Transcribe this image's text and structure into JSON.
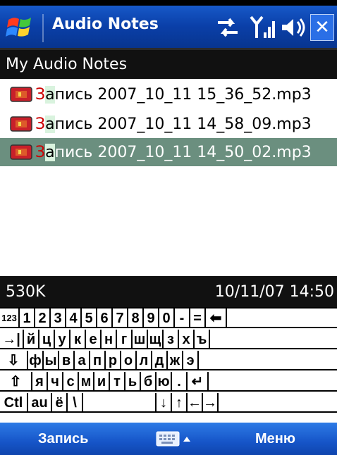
{
  "title_bar": {
    "app_title": "Audio Notes",
    "icons": [
      "windows-start-icon",
      "sync-icon",
      "signal-icon",
      "volume-icon",
      "close-icon"
    ],
    "close_label": "✕"
  },
  "header": {
    "title": "My Audio Notes"
  },
  "files": [
    {
      "prefix": "З",
      "rest_first": "а",
      "rest": "пись 2007_10_11 15_36_52.mp3",
      "selected": false
    },
    {
      "prefix": "З",
      "rest_first": "а",
      "rest": "пись 2007_10_11 14_58_09.mp3",
      "selected": false
    },
    {
      "prefix": "З",
      "rest_first": "а",
      "rest": "пись 2007_10_11 14_50_02.mp3",
      "selected": true
    }
  ],
  "status": {
    "size": "530K",
    "datetime": "10/11/07 14:50"
  },
  "keyboard": {
    "rows": [
      [
        "123",
        "1",
        "2",
        "3",
        "4",
        "5",
        "6",
        "7",
        "8",
        "9",
        "0",
        "-",
        "=",
        "⬅"
      ],
      [
        "→|",
        "й",
        "ц",
        "у",
        "к",
        "е",
        "н",
        "г",
        "ш",
        "щ",
        "з",
        "х",
        "ъ"
      ],
      [
        "⇩",
        "ф",
        "ы",
        "в",
        "а",
        "п",
        "р",
        "о",
        "л",
        "д",
        "ж",
        "э"
      ],
      [
        "⇧",
        "я",
        "ч",
        "с",
        "м",
        "и",
        "т",
        "ь",
        "б",
        "ю",
        ".",
        "↵"
      ],
      [
        "Ctl",
        "au",
        "ё",
        "\\",
        "",
        "↓",
        "↑",
        "←",
        "→"
      ]
    ]
  },
  "menu": {
    "left": "Запись",
    "right": "Меню",
    "kb_arrow": "▲"
  },
  "colors": {
    "titlebar": "#0a3fa8",
    "selected_row": "#6b8f7f",
    "prefix_red": "#cc0000"
  }
}
